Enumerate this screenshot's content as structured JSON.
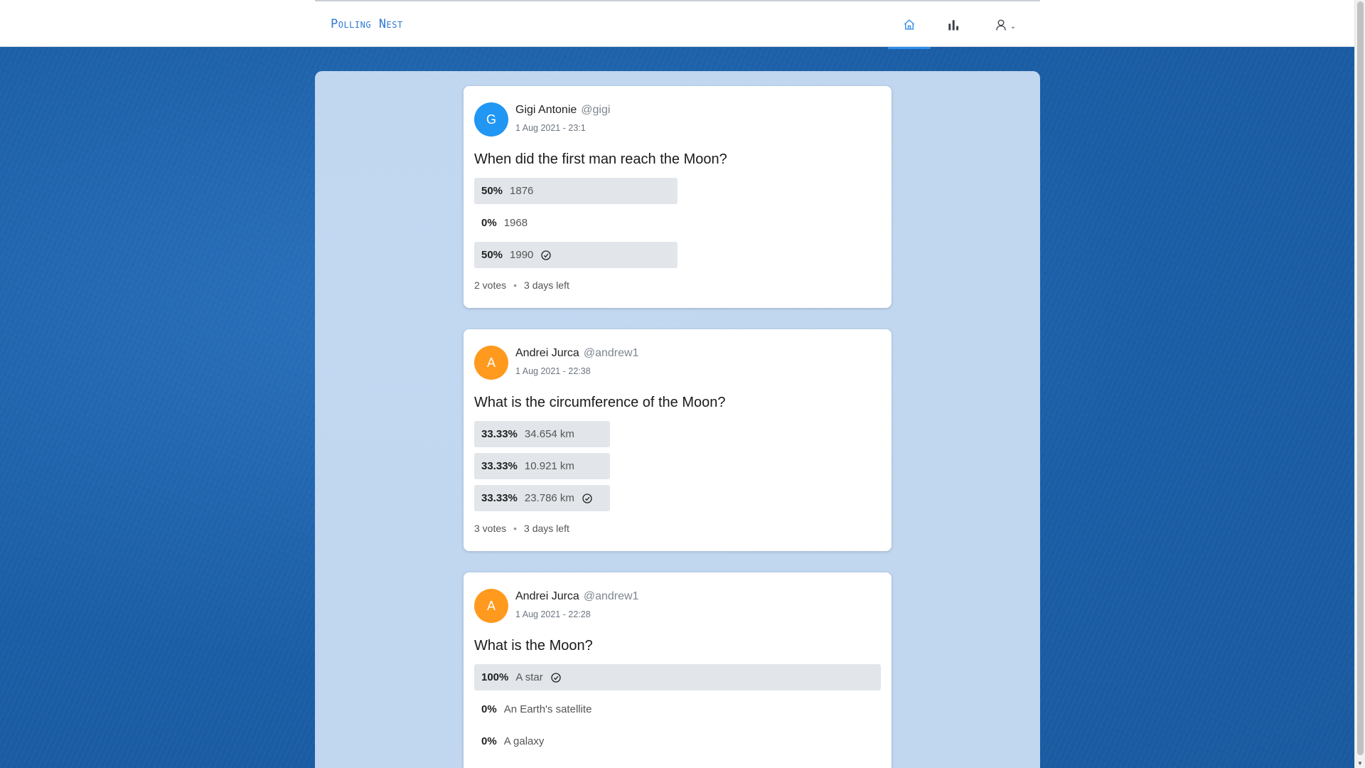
{
  "brand": "Polling Nest",
  "nav": {
    "home_icon": "home-icon",
    "stats_icon": "bar-chart-icon",
    "user_icon": "user-icon",
    "chevron_icon": "chevron-down-icon",
    "accent": "#2d8ce6"
  },
  "polls": [
    {
      "avatar_letter": "G",
      "avatar_color": "#2196f3",
      "author": "Gigi Antonie",
      "handle": "@gigi",
      "date": "1 Aug 2021 - 23:1",
      "question": "When did the first man reach the Moon?",
      "options": [
        {
          "pct": "50%",
          "text": "1876",
          "fraction": 0.5,
          "checked": false
        },
        {
          "pct": "0%",
          "text": "1968",
          "fraction": 0,
          "checked": false
        },
        {
          "pct": "50%",
          "text": "1990",
          "fraction": 0.5,
          "checked": true
        }
      ],
      "votes": "2 votes",
      "time_left": "3 days left"
    },
    {
      "avatar_letter": "A",
      "avatar_color": "#ff9a1f",
      "author": "Andrei Jurca",
      "handle": "@andrew1",
      "date": "1 Aug 2021 - 22:38",
      "question": "What is the circumference of the Moon?",
      "options": [
        {
          "pct": "33.33%",
          "text": "34.654 km",
          "fraction": 0.3333,
          "checked": false
        },
        {
          "pct": "33.33%",
          "text": "10.921 km",
          "fraction": 0.3333,
          "checked": false
        },
        {
          "pct": "33.33%",
          "text": "23.786 km",
          "fraction": 0.3333,
          "checked": true
        }
      ],
      "votes": "3 votes",
      "time_left": "3 days left"
    },
    {
      "avatar_letter": "A",
      "avatar_color": "#ff9a1f",
      "author": "Andrei Jurca",
      "handle": "@andrew1",
      "date": "1 Aug 2021 - 22:28",
      "question": "What is the Moon?",
      "options": [
        {
          "pct": "100%",
          "text": "A star",
          "fraction": 1,
          "checked": true
        },
        {
          "pct": "0%",
          "text": "An Earth's satellite",
          "fraction": 0,
          "checked": false
        },
        {
          "pct": "0%",
          "text": "A galaxy",
          "fraction": 0,
          "checked": false
        }
      ],
      "votes": "",
      "time_left": ""
    }
  ]
}
